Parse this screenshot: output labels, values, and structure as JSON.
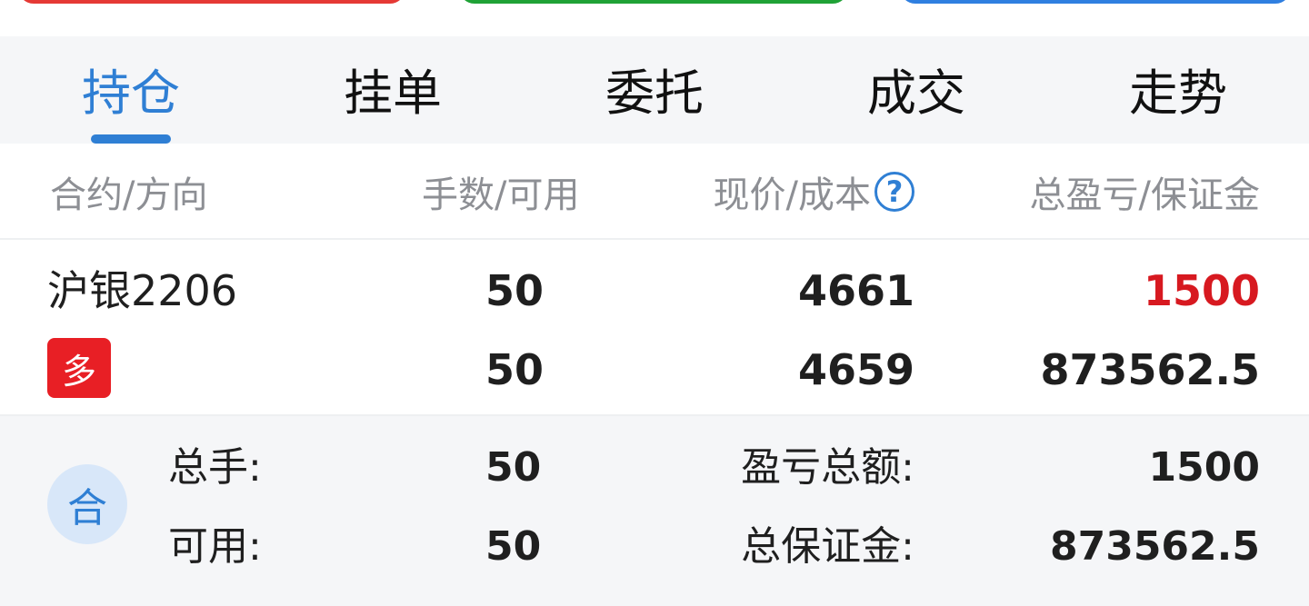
{
  "tabs": [
    {
      "label": "持仓",
      "active": true
    },
    {
      "label": "挂单",
      "active": false
    },
    {
      "label": "委托",
      "active": false
    },
    {
      "label": "成交",
      "active": false
    },
    {
      "label": "走势",
      "active": false
    }
  ],
  "header": {
    "contract_direction": "合约/方向",
    "lots_available": "手数/可用",
    "price_cost": "现价/成本",
    "help_glyph": "?",
    "pnl_margin": "总盈亏/保证金"
  },
  "position": {
    "contract": "沪银2206",
    "direction": "多",
    "lots": "50",
    "available": "50",
    "current_price": "4661",
    "cost": "4659",
    "total_pnl": "1500",
    "margin": "873562.5"
  },
  "summary": {
    "icon_label": "合",
    "total_lots_label": "总手:",
    "total_lots": "50",
    "available_label": "可用:",
    "available": "50",
    "pnl_total_label": "盈亏总额:",
    "pnl_total": "1500",
    "total_margin_label": "总保证金:",
    "total_margin": "873562.5"
  },
  "colors": {
    "accent": "#2f7fd4",
    "profit": "#d71920",
    "long_badge": "#e81f25",
    "button_red": "#e53935",
    "button_green": "#1fa236",
    "button_blue": "#2f7fe0"
  }
}
